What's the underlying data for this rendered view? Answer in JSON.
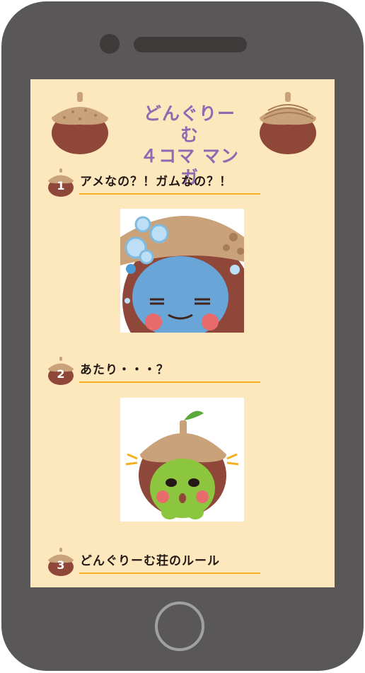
{
  "header": {
    "title_line1": "どんぐりーむ",
    "title_line2": "４コマ マンガ"
  },
  "sections": [
    {
      "number": "1",
      "title": "アメなの？！ガムなの？！",
      "thumb_label": "comic-1-thumbnail"
    },
    {
      "number": "2",
      "title": "あたり・・・？",
      "thumb_label": "comic-2-thumbnail"
    },
    {
      "number": "3",
      "title": "どんぐりーむ荘のルール"
    }
  ],
  "colors": {
    "phone_body": "#595757",
    "screen_bg": "#fde8bd",
    "title": "#8c6bb1",
    "underline": "#f3b11e",
    "acorn_cap": "#c9a27a",
    "acorn_body": "#8e4738"
  },
  "icons": {
    "acorn": "acorn-icon",
    "home": "home-button",
    "camera": "camera-dot"
  }
}
